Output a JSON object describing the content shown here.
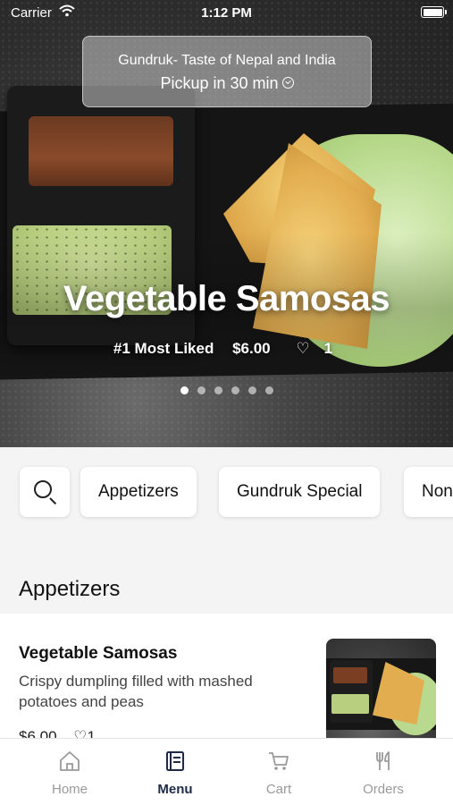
{
  "status_bar": {
    "carrier": "Carrier",
    "time": "1:12 PM"
  },
  "store": {
    "name": "Gundruk- Taste of Nepal and India",
    "pickup": "Pickup in 30 min"
  },
  "hero": {
    "title": "Vegetable Samosas",
    "rank": "#1 Most Liked",
    "price": "$6.00",
    "likes": "1",
    "carousel_pages": 6,
    "carousel_active": 1
  },
  "categories": [
    "Appetizers",
    "Gundruk Special",
    "Non"
  ],
  "section": {
    "title": "Appetizers"
  },
  "items": [
    {
      "name": "Vegetable Samosas",
      "description": "Crispy dumpling filled with mashed potatoes and peas",
      "price": "$6.00",
      "likes": "1"
    }
  ],
  "tabs": [
    {
      "label": "Home",
      "icon": "home-icon",
      "active": false
    },
    {
      "label": "Menu",
      "icon": "menu-book-icon",
      "active": true
    },
    {
      "label": "Cart",
      "icon": "cart-icon",
      "active": false
    },
    {
      "label": "Orders",
      "icon": "fork-knife-icon",
      "active": false
    }
  ],
  "colors": {
    "active_tab": "#1f2a44",
    "inactive_tab": "#9a9a9a",
    "background": "#f4f4f4"
  }
}
